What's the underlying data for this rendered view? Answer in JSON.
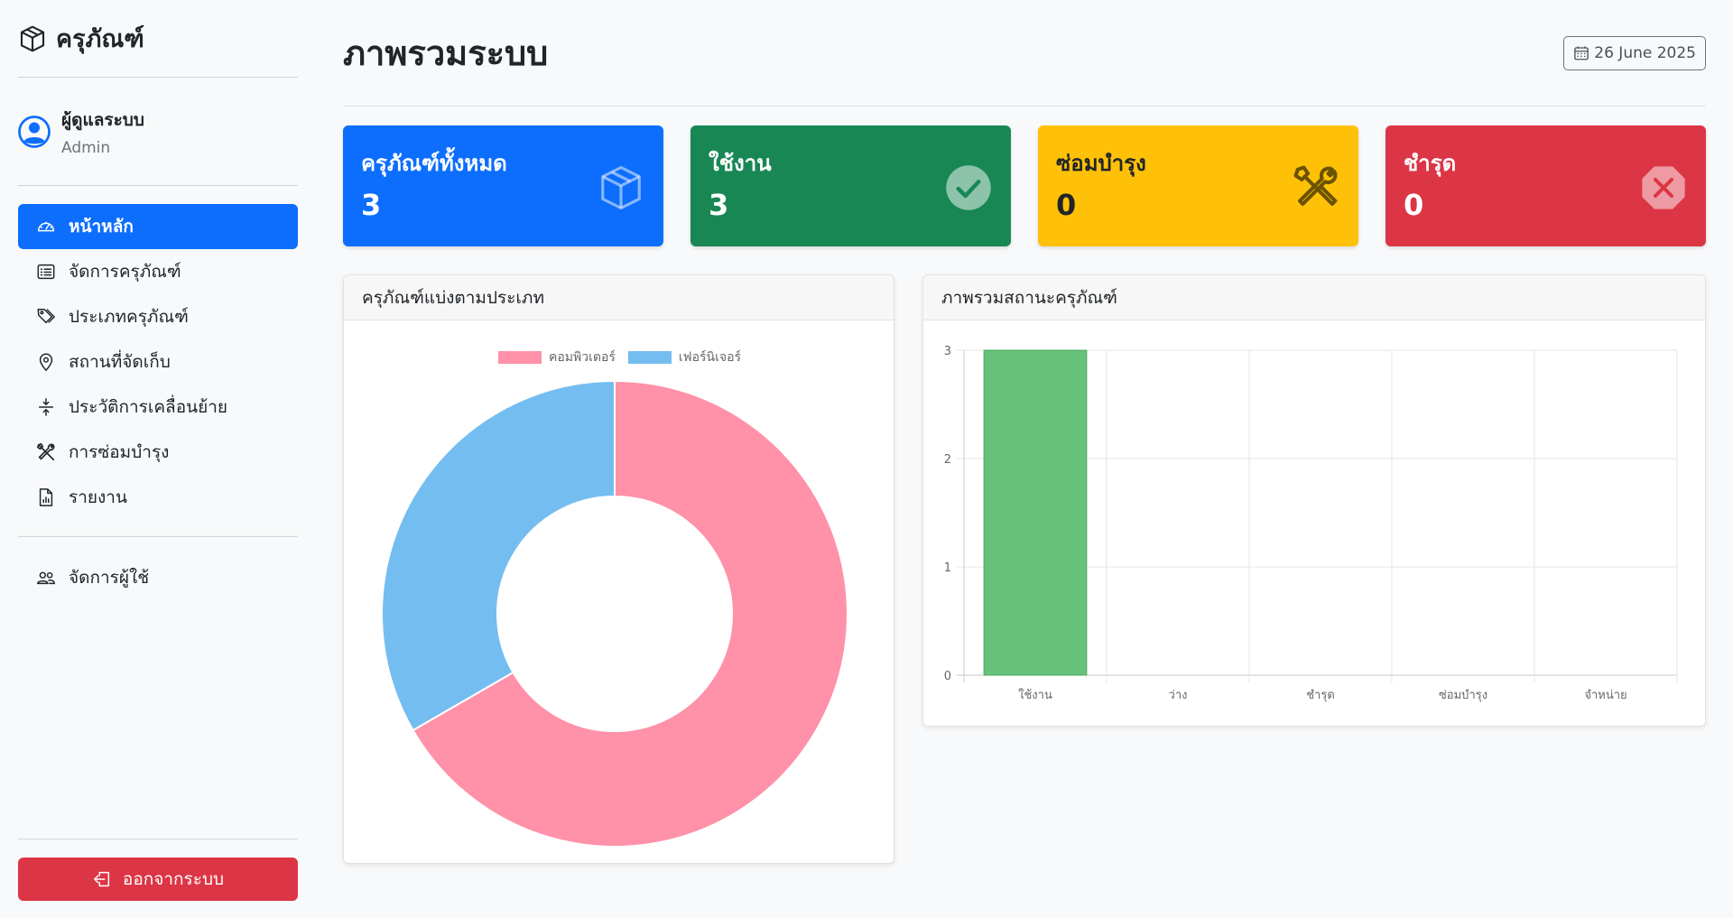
{
  "sidebar": {
    "brand": "ครุภัณฑ์",
    "user": {
      "name": "ผู้ดูแลระบบ",
      "role": "Admin"
    },
    "nav": [
      {
        "label": "หน้าหลัก",
        "icon": "speedometer-icon",
        "active": true
      },
      {
        "label": "จัดการครุภัณฑ์",
        "icon": "list-icon"
      },
      {
        "label": "ประเภทครุภัณฑ์",
        "icon": "tags-icon"
      },
      {
        "label": "สถานที่จัดเก็บ",
        "icon": "geo-pin-icon"
      },
      {
        "label": "ประวัติการเคลื่อนย้าย",
        "icon": "arrows-vertical-icon"
      },
      {
        "label": "การซ่อมบำรุง",
        "icon": "tools-icon"
      },
      {
        "label": "รายงาน",
        "icon": "file-chart-icon"
      }
    ],
    "nav2": [
      {
        "label": "จัดการผู้ใช้",
        "icon": "people-icon"
      }
    ],
    "logout_label": "ออกจากระบบ"
  },
  "header": {
    "title": "ภาพรวมระบบ",
    "date": "26 June 2025"
  },
  "cards": [
    {
      "title": "ครุภัณฑ์ทั้งหมด",
      "value": "3",
      "color": "#0d6efd",
      "icon": "box-icon"
    },
    {
      "title": "ใช้งาน",
      "value": "3",
      "color": "#198754",
      "icon": "check-circle-icon"
    },
    {
      "title": "ซ่อมบำรุง",
      "value": "0",
      "color": "#ffc107",
      "icon": "tools-icon"
    },
    {
      "title": "ชำรุด",
      "value": "0",
      "color": "#dc3545",
      "icon": "x-octagon-icon"
    }
  ],
  "panels": {
    "by_type_title": "ครุภัณฑ์แบ่งตามประเภท",
    "status_title": "ภาพรวมสถานะครุภัณฑ์"
  },
  "chart_data": [
    {
      "type": "pie",
      "title": "",
      "labels": [
        "คอมพิวเตอร์",
        "เฟอร์นิเจอร์"
      ],
      "values": [
        2,
        1
      ],
      "colors": [
        "#ff91a8",
        "#74bdf0"
      ],
      "legend": "top"
    },
    {
      "type": "bar",
      "title": "",
      "categories": [
        "ใช้งาน",
        "ว่าง",
        "ชำรุด",
        "ซ่อมบำรุง",
        "จำหน่าย"
      ],
      "values": [
        3,
        0,
        0,
        0,
        0
      ],
      "ylim": [
        0,
        3
      ],
      "yticks": [
        "0",
        "1",
        "2",
        "3"
      ],
      "color": "#66c27a",
      "grid": true
    }
  ]
}
